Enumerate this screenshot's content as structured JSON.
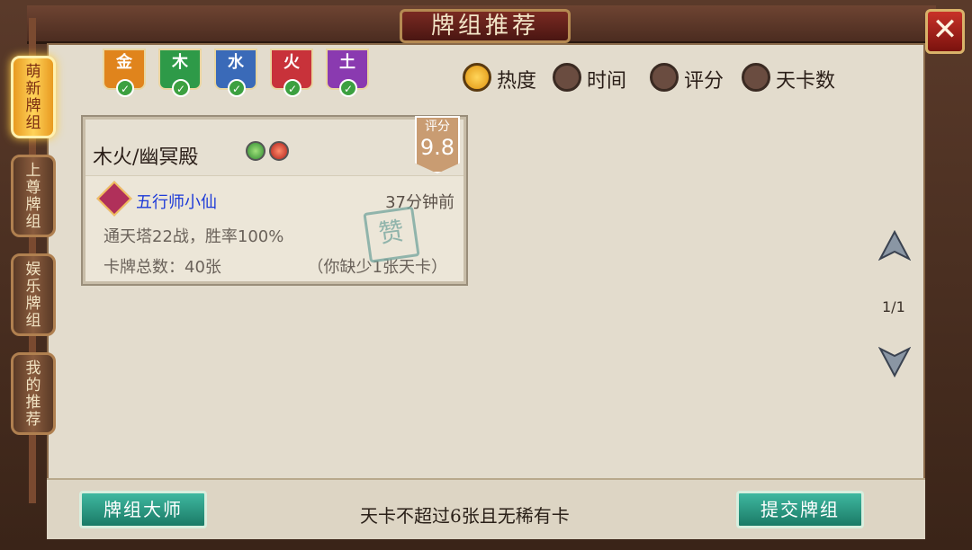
{
  "title": "牌组推荐",
  "side_tabs": [
    {
      "label": "萌新牌组",
      "active": true
    },
    {
      "label": "上尊牌组",
      "active": false
    },
    {
      "label": "娱乐牌组",
      "active": false
    },
    {
      "label": "我的推荐",
      "active": false
    }
  ],
  "elements": [
    {
      "label": "金",
      "color": "#e0841c",
      "checked": true
    },
    {
      "label": "木",
      "color": "#2e9a48",
      "checked": true
    },
    {
      "label": "水",
      "color": "#3a6ab8",
      "checked": true
    },
    {
      "label": "火",
      "color": "#c8323a",
      "checked": true
    },
    {
      "label": "土",
      "color": "#8a3ab0",
      "checked": true
    }
  ],
  "sort_options": [
    {
      "label": "热度",
      "selected": true
    },
    {
      "label": "时间",
      "selected": false
    },
    {
      "label": "评分",
      "selected": false
    },
    {
      "label": "天卡数",
      "selected": false
    }
  ],
  "deck_card": {
    "title": "木火/幽冥殿",
    "element_icons": [
      "wood-icon",
      "fire-icon"
    ],
    "score_label": "评分",
    "score": "9.8",
    "author": "五行师小仙",
    "time": "37分钟前",
    "record": "通天塔22战，胜率100%",
    "total": "卡牌总数：40张",
    "missing": "（你缺少1张天卡）",
    "stamp": "赞"
  },
  "pagination": "1/1",
  "buttons": {
    "master": "牌组大师",
    "submit": "提交牌组"
  },
  "rule_text": "天卡不超过6张且无稀有卡"
}
